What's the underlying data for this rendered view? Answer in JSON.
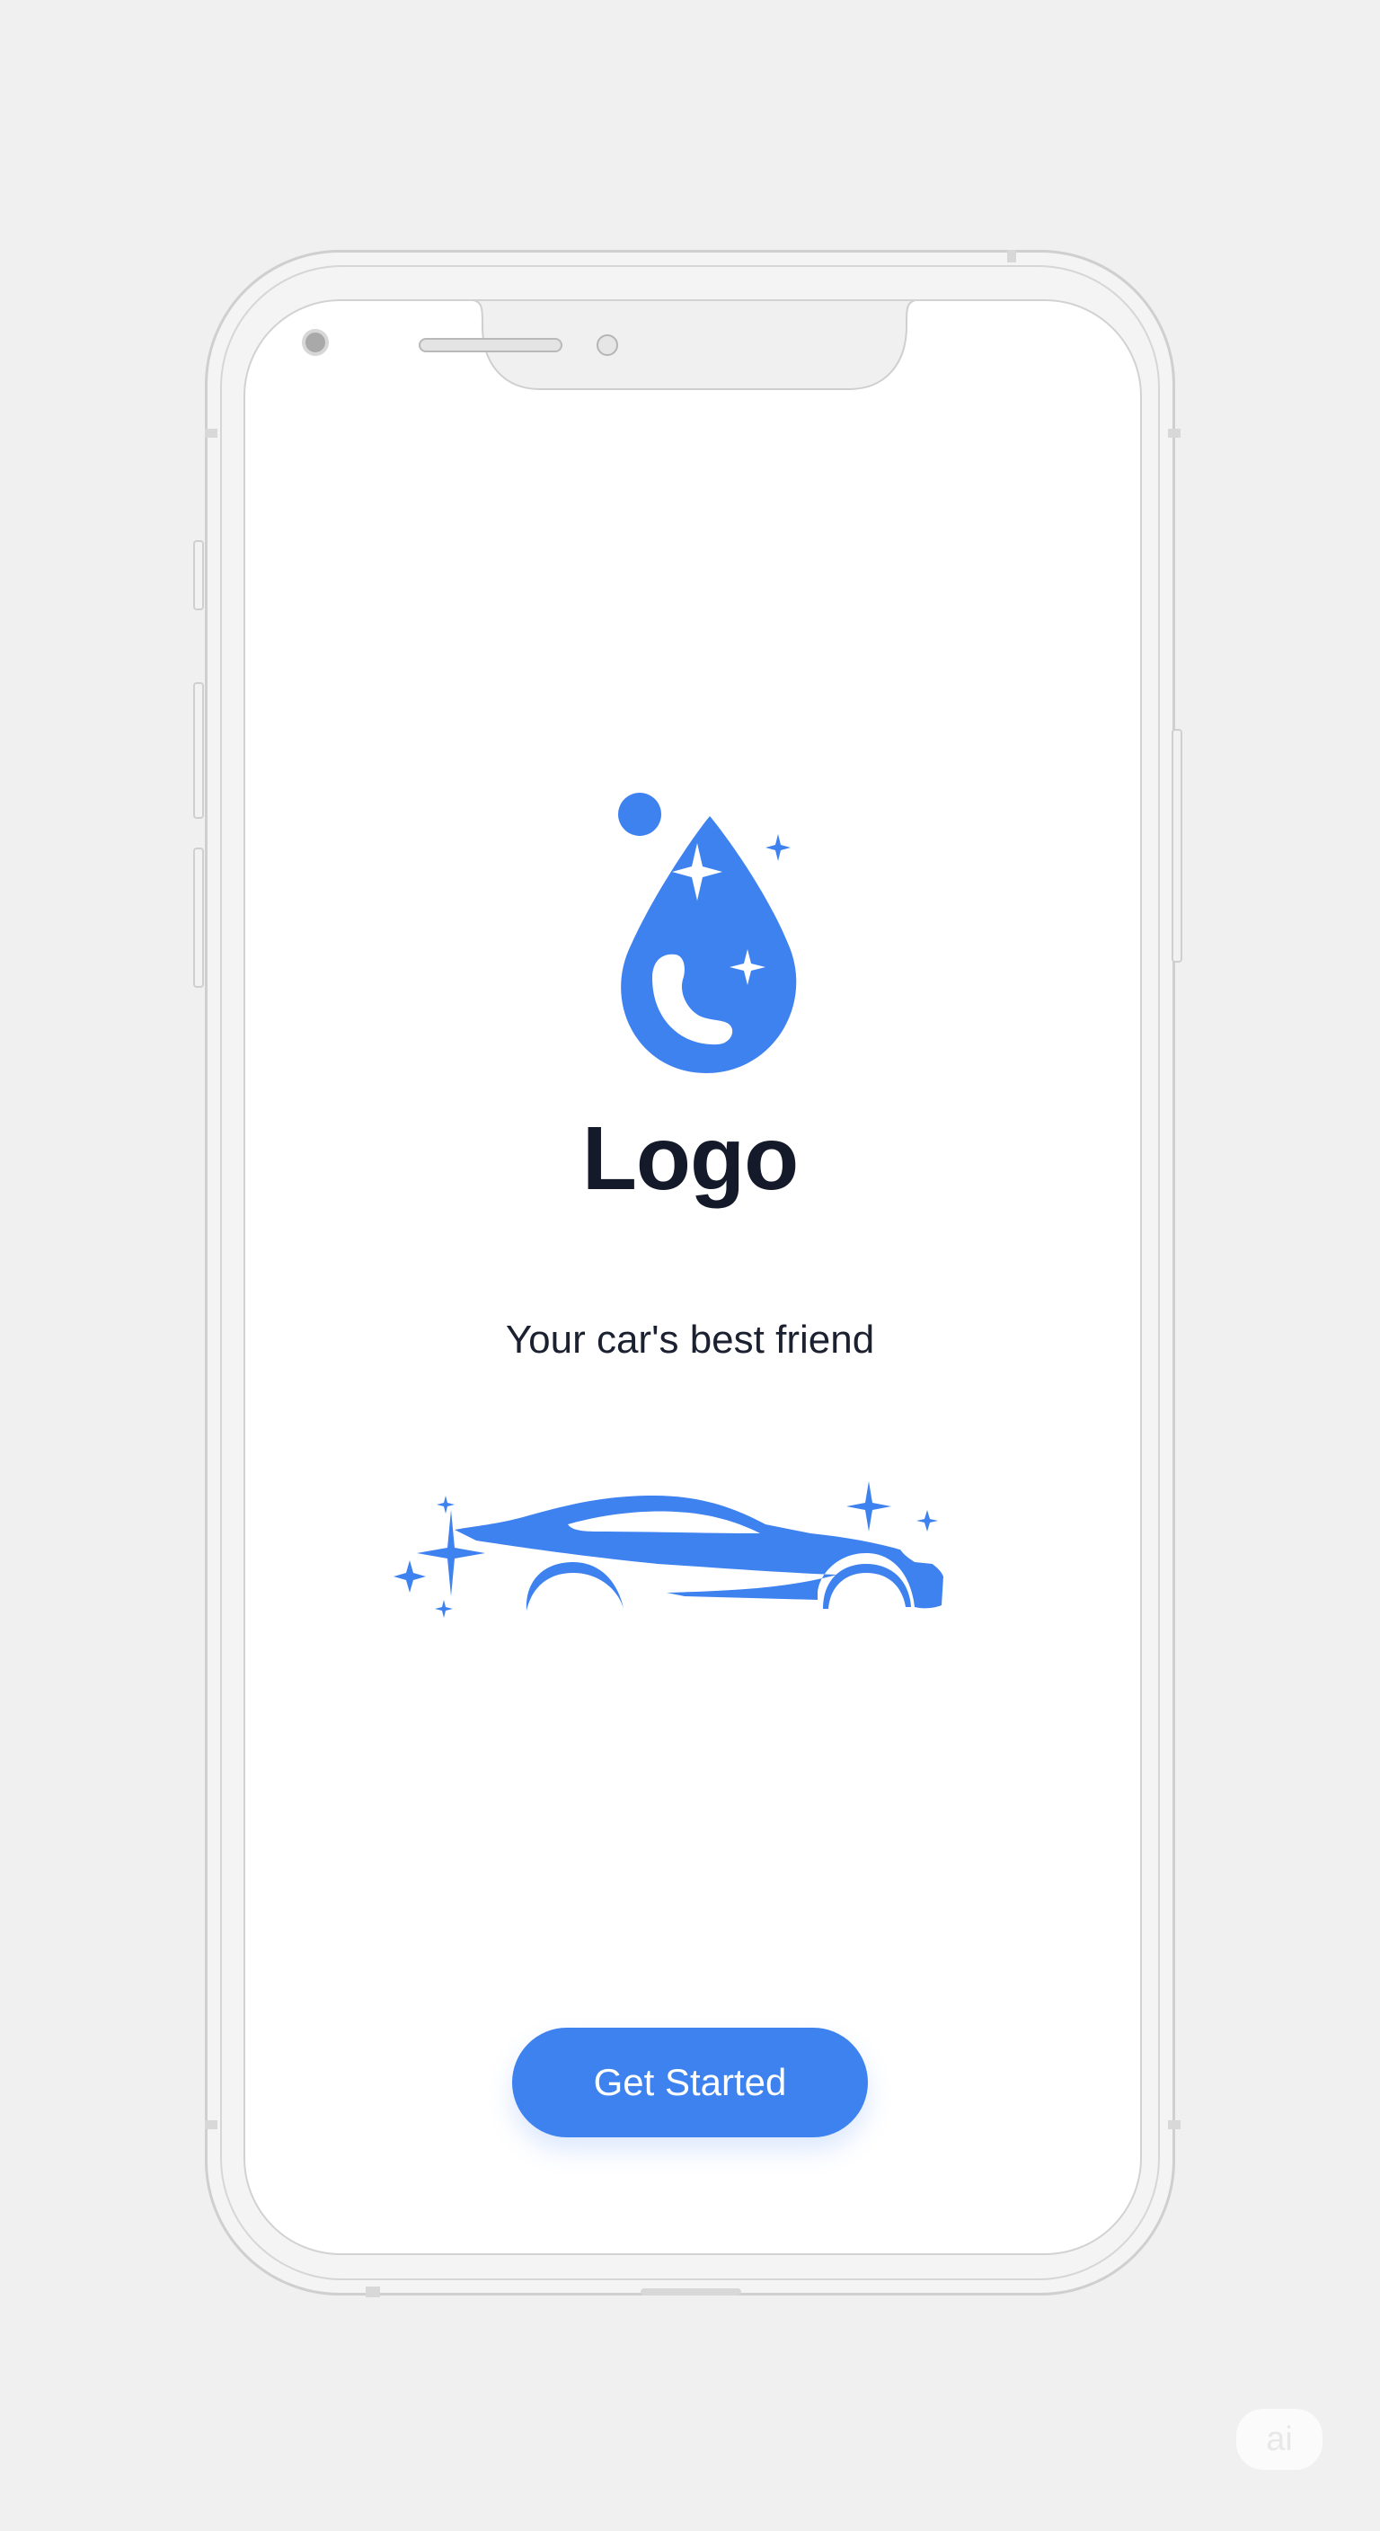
{
  "app": {
    "logo_text": "Logo",
    "tagline": "Your car's best friend",
    "cta_label": "Get Started"
  },
  "icons": {
    "logo": "water-drop-phone-icon",
    "hero": "car-sparkle-icon"
  },
  "watermark": {
    "text": "ai"
  },
  "colors": {
    "accent": "#3e82f0",
    "title": "#141a2a",
    "background": "#f0f0f0",
    "screen": "#ffffff"
  }
}
